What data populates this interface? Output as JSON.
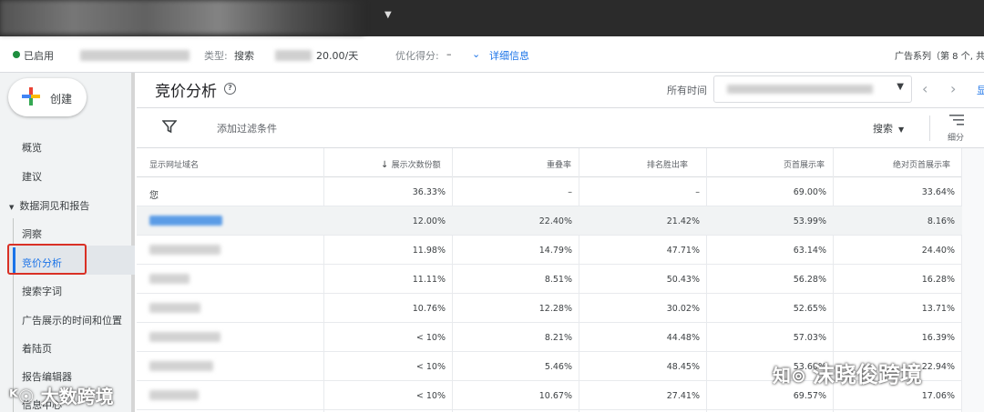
{
  "statusbar": {
    "status": "已启用",
    "type_label": "类型:",
    "type_value": "搜索",
    "budget": "20.00/天",
    "opt_label": "优化得分:",
    "opt_value": "–",
    "details_link": "详细信息",
    "campaign_info": "广告系列（第 8 个, 共"
  },
  "colors": {
    "accent": "#1a73e8",
    "status_green": "#1e8e3e",
    "highlight_red": "#d93025"
  },
  "nav": {
    "create_label": "创建",
    "items": [
      {
        "label": "概览"
      },
      {
        "label": "建议"
      },
      {
        "label": "数据洞见和报告",
        "section": true
      },
      {
        "label": "洞察"
      },
      {
        "label": "竞价分析",
        "active": true
      },
      {
        "label": "搜索字词"
      },
      {
        "label": "广告展示的时间和位置"
      },
      {
        "label": "着陆页"
      },
      {
        "label": "报告编辑器"
      },
      {
        "label": "信息中心"
      }
    ]
  },
  "header": {
    "title": "竞价分析",
    "date_label": "所有时间"
  },
  "toolbar": {
    "add_filter": "添加过滤条件",
    "search_label": "搜索",
    "segment_label": "细分"
  },
  "table": {
    "columns": [
      "显示网址域名",
      "展示次数份额",
      "重叠率",
      "排名胜出率",
      "页首展示率",
      "绝对页首展示率"
    ],
    "sort_column": "展示次数份额",
    "rows": [
      {
        "domain": "您",
        "impr_share": "36.33%",
        "overlap": "–",
        "outranking": "–",
        "top": "69.00%",
        "abs_top": "33.64%"
      },
      {
        "domain": "",
        "impr_share": "12.00%",
        "overlap": "22.40%",
        "outranking": "21.42%",
        "top": "53.99%",
        "abs_top": "8.16%"
      },
      {
        "domain": "",
        "impr_share": "11.98%",
        "overlap": "14.79%",
        "outranking": "47.71%",
        "top": "63.14%",
        "abs_top": "24.40%"
      },
      {
        "domain": "",
        "impr_share": "11.11%",
        "overlap": "8.51%",
        "outranking": "50.43%",
        "top": "56.28%",
        "abs_top": "16.28%"
      },
      {
        "domain": "",
        "impr_share": "10.76%",
        "overlap": "12.28%",
        "outranking": "30.02%",
        "top": "52.65%",
        "abs_top": "13.71%"
      },
      {
        "domain": "",
        "impr_share": "< 10%",
        "overlap": "8.21%",
        "outranking": "44.48%",
        "top": "57.03%",
        "abs_top": "16.39%"
      },
      {
        "domain": "",
        "impr_share": "< 10%",
        "overlap": "5.46%",
        "outranking": "48.45%",
        "top": "53.60%",
        "abs_top": "22.94%"
      },
      {
        "domain": "",
        "impr_share": "< 10%",
        "overlap": "10.67%",
        "outranking": "27.41%",
        "top": "69.57%",
        "abs_top": "17.06%"
      }
    ]
  },
  "watermarks": {
    "left": "大数跨境",
    "right": "沫晓俊跨境"
  }
}
